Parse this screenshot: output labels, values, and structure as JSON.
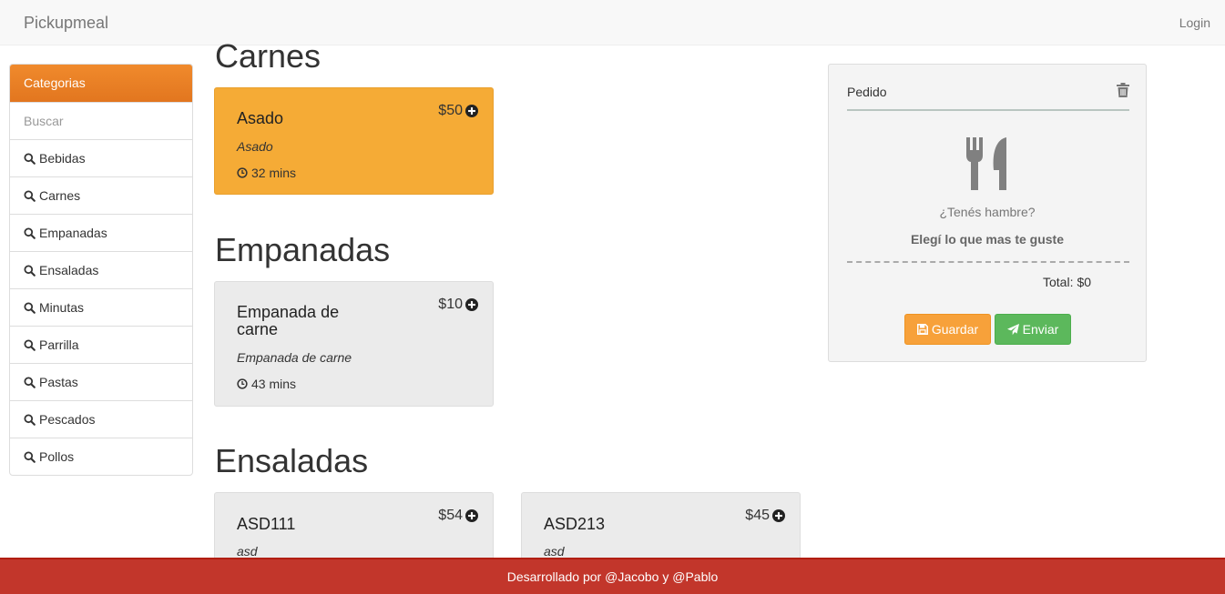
{
  "navbar": {
    "brand": "Pickupmeal",
    "login": "Login"
  },
  "sidebar": {
    "title": "Categorias",
    "search_placeholder": "Buscar",
    "items": [
      {
        "label": "Bebidas"
      },
      {
        "label": "Carnes"
      },
      {
        "label": "Empanadas"
      },
      {
        "label": "Ensaladas"
      },
      {
        "label": "Minutas"
      },
      {
        "label": "Parrilla"
      },
      {
        "label": "Pastas"
      },
      {
        "label": "Pescados"
      },
      {
        "label": "Pollos"
      }
    ]
  },
  "sections": [
    {
      "title": "Carnes",
      "items": [
        {
          "name": "Asado",
          "price": "$50",
          "desc": "Asado",
          "time": "32 mins"
        }
      ]
    },
    {
      "title": "Empanadas",
      "items": [
        {
          "name": "Empanada de carne",
          "price": "$10",
          "desc": "Empanada de carne",
          "time": "43 mins"
        }
      ]
    },
    {
      "title": "Ensaladas",
      "items": [
        {
          "name": "ASD111",
          "price": "$54",
          "desc": "asd"
        },
        {
          "name": "ASD213",
          "price": "$45",
          "desc": "asd"
        }
      ]
    }
  ],
  "order": {
    "title": "Pedido",
    "empty_question": "¿Tenés hambre?",
    "empty_hint": "Elegí lo que mas te guste",
    "total_label": "Total:",
    "total_value": "$0",
    "save_label": "Guardar",
    "send_label": "Enviar"
  },
  "footer": {
    "text": "Desarrollado por @Jacobo y @Pablo"
  },
  "colors": {
    "accent_orange": "#e2761f",
    "highlight_card": "#f5ab36",
    "save_button": "#f7a13a",
    "send_button": "#5cb85c",
    "footer": "#c2362b"
  }
}
